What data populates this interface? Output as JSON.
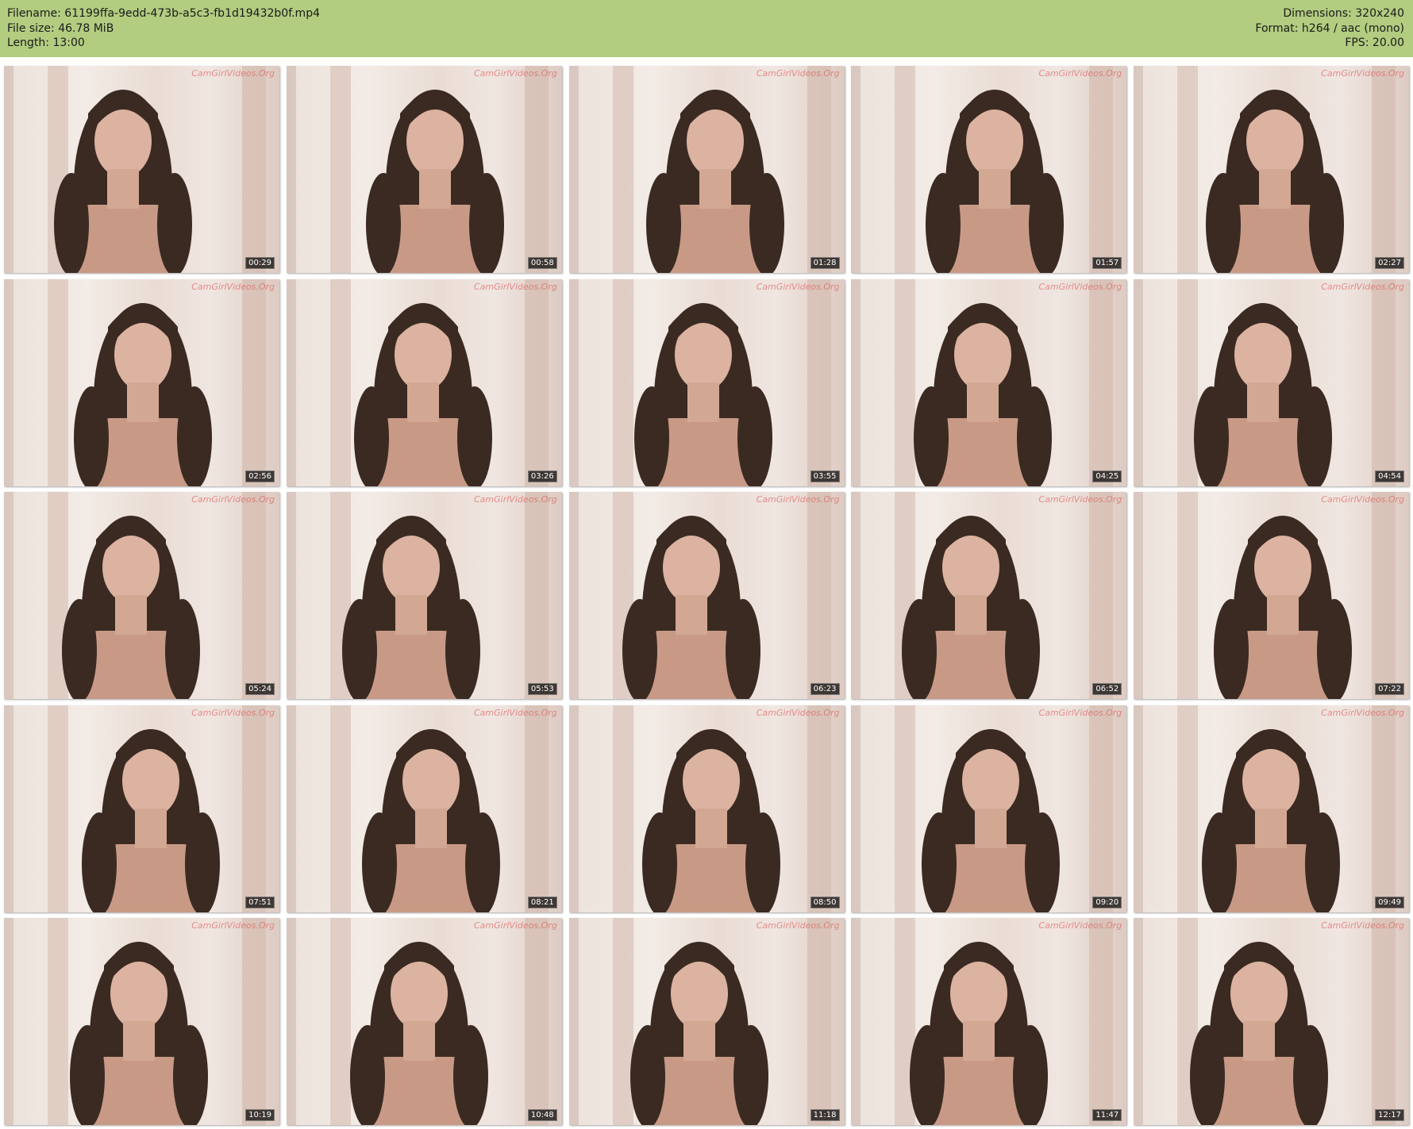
{
  "header": {
    "filename": "Filename: 61199ffa-9edd-473b-a5c3-fb1d19432b0f.mp4",
    "file_size": "File size: 46.78 MiB",
    "length": "Length: 13:00",
    "dimensions": "Dimensions: 320x240",
    "format": "Format: h264 / aac (mono)",
    "fps": "FPS: 20.00",
    "background_color": "#b2cc80"
  },
  "watermark": "CamGirlVideos.Org",
  "thumbnails": [
    "00:29",
    "00:58",
    "01:28",
    "01:57",
    "02:27",
    "02:56",
    "03:26",
    "03:55",
    "04:25",
    "04:54",
    "05:24",
    "05:53",
    "06:23",
    "06:52",
    "07:22",
    "07:51",
    "08:21",
    "08:50",
    "09:20",
    "09:49",
    "10:19",
    "10:48",
    "11:18",
    "11:47",
    "12:17"
  ]
}
